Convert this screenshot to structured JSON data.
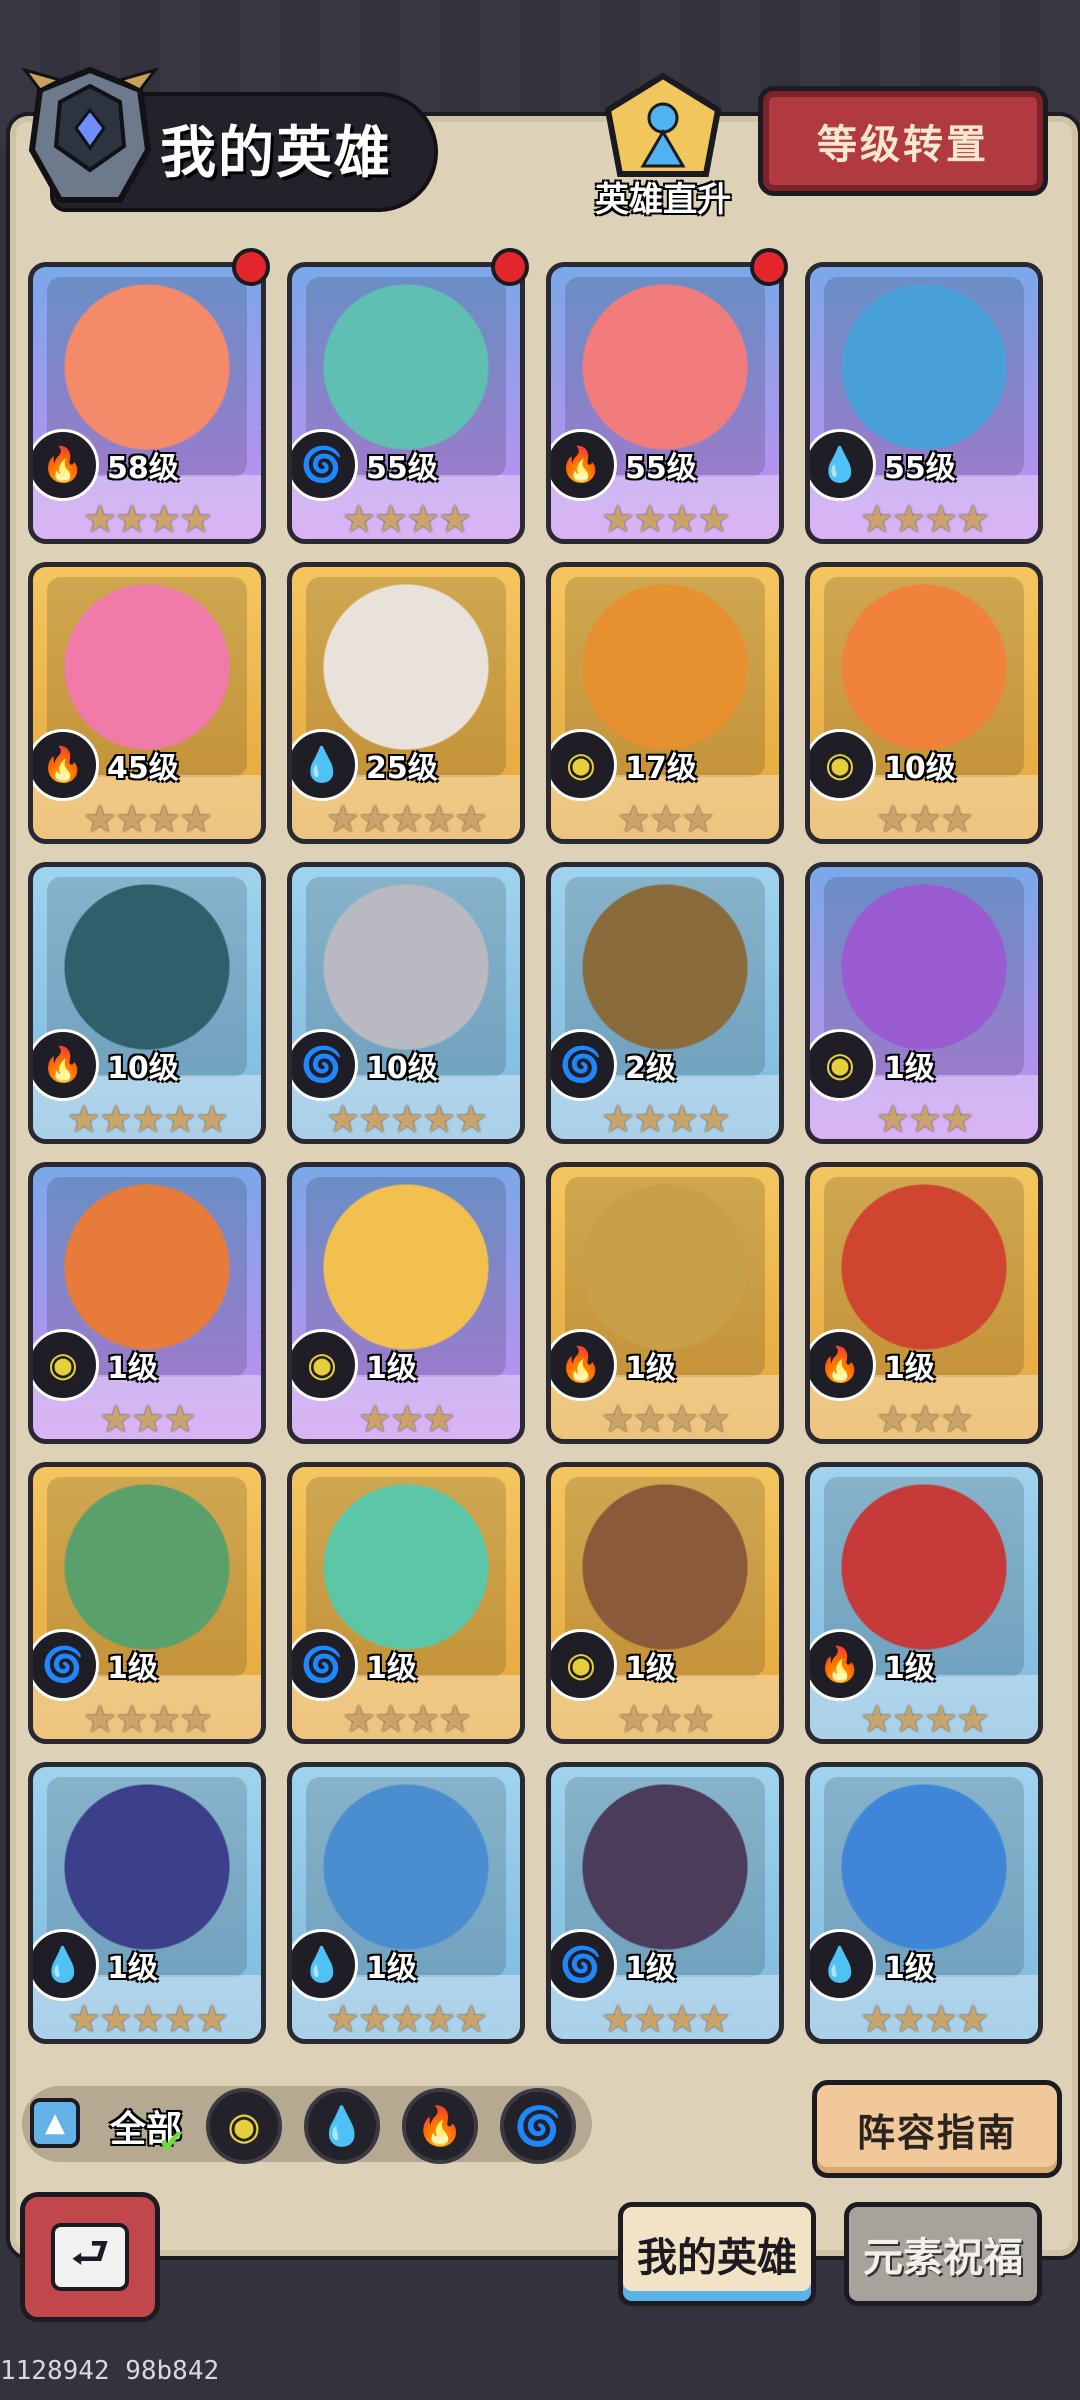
{
  "header": {
    "title": "我的英雄",
    "direct_up_label": "英雄直升",
    "level_transfer_label": "等级转置"
  },
  "heroes": [
    {
      "level": "58级",
      "element": "fire",
      "stars": 4,
      "frame": "purple",
      "badge": true
    },
    {
      "level": "55级",
      "element": "wind",
      "stars": 4,
      "frame": "purple",
      "badge": true
    },
    {
      "level": "55级",
      "element": "fire",
      "stars": 4,
      "frame": "purple",
      "badge": true
    },
    {
      "level": "55级",
      "element": "water",
      "stars": 4,
      "frame": "purple",
      "badge": false
    },
    {
      "level": "45级",
      "element": "fire",
      "stars": 4,
      "frame": "gold",
      "badge": false
    },
    {
      "level": "25级",
      "element": "water",
      "stars": 5,
      "frame": "gold",
      "badge": false
    },
    {
      "level": "17级",
      "element": "earth",
      "stars": 3,
      "frame": "gold",
      "badge": false
    },
    {
      "level": "10级",
      "element": "earth",
      "stars": 3,
      "frame": "gold",
      "badge": false
    },
    {
      "level": "10级",
      "element": "fire",
      "stars": 5,
      "frame": "blue",
      "badge": false
    },
    {
      "level": "10级",
      "element": "wind",
      "stars": 5,
      "frame": "blue",
      "badge": false
    },
    {
      "level": "2级",
      "element": "wind",
      "stars": 4,
      "frame": "blue",
      "badge": false
    },
    {
      "level": "1级",
      "element": "earth",
      "stars": 3,
      "frame": "purple",
      "badge": false
    },
    {
      "level": "1级",
      "element": "earth",
      "stars": 3,
      "frame": "purple",
      "badge": false
    },
    {
      "level": "1级",
      "element": "earth",
      "stars": 3,
      "frame": "purple",
      "badge": false
    },
    {
      "level": "1级",
      "element": "fire",
      "stars": 4,
      "frame": "gold",
      "badge": false
    },
    {
      "level": "1级",
      "element": "fire",
      "stars": 3,
      "frame": "gold",
      "badge": false
    },
    {
      "level": "1级",
      "element": "wind",
      "stars": 4,
      "frame": "gold",
      "badge": false
    },
    {
      "level": "1级",
      "element": "wind",
      "stars": 4,
      "frame": "gold",
      "badge": false
    },
    {
      "level": "1级",
      "element": "earth",
      "stars": 3,
      "frame": "gold",
      "badge": false
    },
    {
      "level": "1级",
      "element": "fire",
      "stars": 4,
      "frame": "blue",
      "badge": false
    },
    {
      "level": "1级",
      "element": "water",
      "stars": 5,
      "frame": "blue",
      "badge": false
    },
    {
      "level": "1级",
      "element": "water",
      "stars": 5,
      "frame": "blue",
      "badge": false
    },
    {
      "level": "1级",
      "element": "wind",
      "stars": 4,
      "frame": "blue",
      "badge": false
    },
    {
      "level": "1级",
      "element": "water",
      "stars": 4,
      "frame": "blue",
      "badge": false
    }
  ],
  "filters": {
    "all_label": "全部",
    "elements": [
      "earth",
      "water",
      "fire",
      "wind"
    ]
  },
  "guide_label": "阵容指南",
  "tabs": [
    "我的英雄",
    "元素祝福"
  ],
  "footer_id": "1128942 98b842",
  "colors": {
    "fire": "#e8484c",
    "water": "#3a9ce6",
    "wind": "#5bcf3a",
    "earth": "#e5cf3a"
  }
}
